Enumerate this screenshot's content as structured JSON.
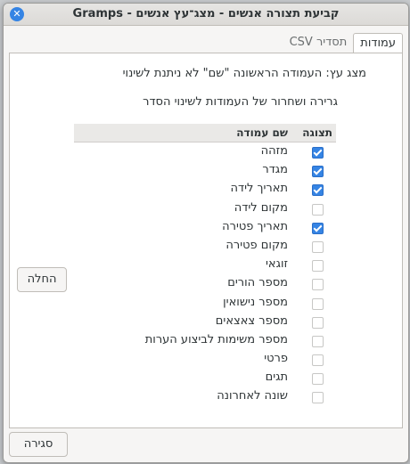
{
  "window": {
    "title": "קביעת תצורה אנשים - מצג־עץ אנשים - Gramps"
  },
  "tabs": [
    {
      "label": "עמודות",
      "active": true
    },
    {
      "label": "תסדיר CSV",
      "active": false
    }
  ],
  "info": {
    "line1": "מצג עץ: העמודה הראשונה \"שם\" לא ניתנת לשינוי",
    "line2": "גרירה ושחרור של העמודות לשינוי הסדר"
  },
  "table": {
    "header_show": "תצוגה",
    "header_name": "שם עמודה",
    "rows": [
      {
        "label": "מזהה",
        "checked": true
      },
      {
        "label": "מגדר",
        "checked": true
      },
      {
        "label": "תאריך לידה",
        "checked": true
      },
      {
        "label": "מקום לידה",
        "checked": false
      },
      {
        "label": "תאריך פטירה",
        "checked": true
      },
      {
        "label": "מקום פטירה",
        "checked": false
      },
      {
        "label": "זוגאי",
        "checked": false
      },
      {
        "label": "מספר הורים",
        "checked": false
      },
      {
        "label": "מספר נישואין",
        "checked": false
      },
      {
        "label": "מספר צאצאים",
        "checked": false
      },
      {
        "label": "מספר משימות לביצוע הערות",
        "checked": false
      },
      {
        "label": "פרטי",
        "checked": false
      },
      {
        "label": "תגים",
        "checked": false
      },
      {
        "label": "שונה לאחרונה",
        "checked": false
      }
    ]
  },
  "buttons": {
    "apply": "החלה",
    "close": "סגירה"
  },
  "colors": {
    "accent": "#3584e4"
  }
}
